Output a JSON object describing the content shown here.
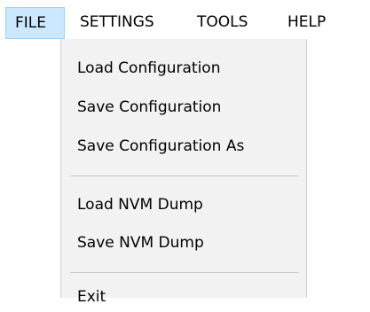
{
  "menubar": {
    "items": [
      {
        "label": "FILE",
        "active": true
      },
      {
        "label": "SETTINGS"
      },
      {
        "label": "TOOLS"
      },
      {
        "label": "HELP"
      }
    ]
  },
  "file_menu": {
    "items": [
      {
        "label": "Load Configuration"
      },
      {
        "label": "Save Configuration"
      },
      {
        "label": "Save Configuration As"
      },
      {
        "label": "Load NVM Dump"
      },
      {
        "label": "Save NVM Dump"
      },
      {
        "label": "Exit"
      }
    ]
  },
  "colors": {
    "active_menu_bg": "#cce8ff",
    "active_menu_border": "#99d1ff",
    "dropdown_bg": "#f2f2f2"
  }
}
